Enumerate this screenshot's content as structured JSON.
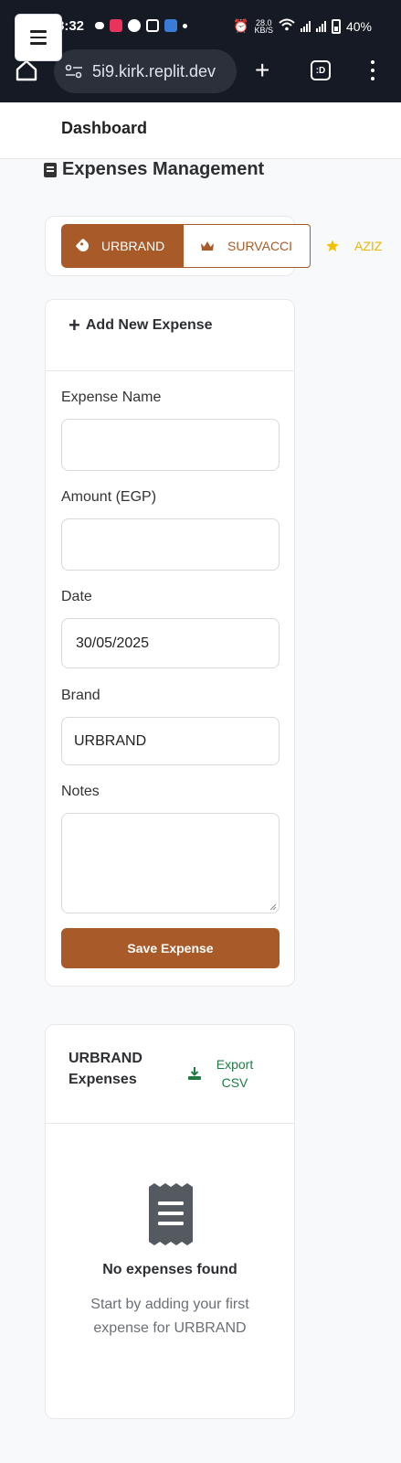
{
  "status_bar": {
    "time": "8:32",
    "network_speed": "28.0",
    "network_unit": "KB/S",
    "battery": "40%"
  },
  "browser": {
    "url": "5i9.kirk.replit.dev",
    "tab_switcher_label": ":D"
  },
  "header": {
    "title": "Dashboard"
  },
  "page": {
    "title": "Expenses Management"
  },
  "brands": [
    {
      "label": "URBRAND",
      "icon": "tag-icon",
      "state": "active"
    },
    {
      "label": "SURVACCI",
      "icon": "crown-icon",
      "state": "outline"
    },
    {
      "label": "AZIZ",
      "icon": "star-icon",
      "state": "plain"
    }
  ],
  "form": {
    "heading": "Add New Expense",
    "name_label": "Expense Name",
    "name_value": "",
    "amount_label": "Amount (EGP)",
    "amount_value": "",
    "date_label": "Date",
    "date_value": "30/05/2025",
    "brand_label": "Brand",
    "brand_value": "URBRAND",
    "notes_label": "Notes",
    "notes_value": "",
    "save_label": "Save Expense"
  },
  "expenses": {
    "title": "URBRAND Expenses",
    "export_label": "Export CSV",
    "empty_title": "No expenses found",
    "empty_text": "Start by adding your first expense for URBRAND"
  },
  "colors": {
    "brand_primary": "#a85a28",
    "export_green": "#1f7a44",
    "star_yellow": "#e6b800"
  }
}
